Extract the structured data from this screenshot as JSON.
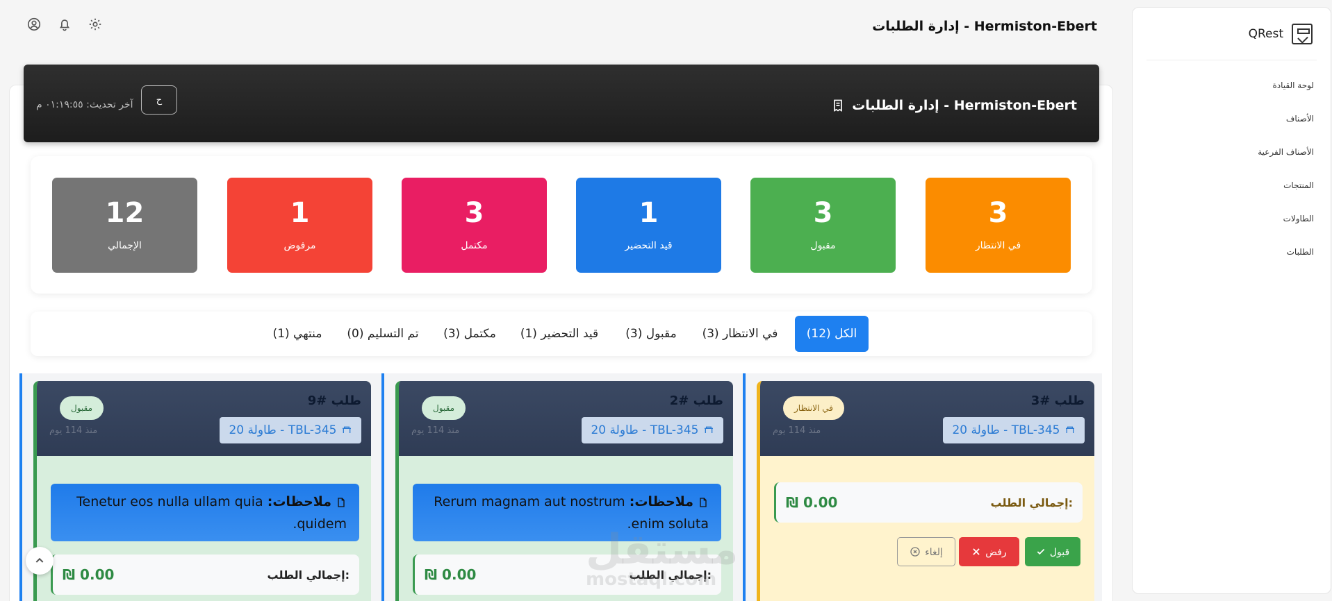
{
  "app": {
    "brand": "QRest",
    "page_title": "إدارة الطلبات - Hermiston-Ebert"
  },
  "sidebar": {
    "items": [
      {
        "label": "لوحة القيادة"
      },
      {
        "label": "الأصناف"
      },
      {
        "label": "الأصناف الفرعية"
      },
      {
        "label": "المنتجات"
      },
      {
        "label": "الطاولات"
      },
      {
        "label": "الطلبات"
      }
    ]
  },
  "topbar": {
    "icons": [
      "user-circle-icon",
      "bell-icon",
      "gear-icon"
    ]
  },
  "banner": {
    "title": "إدارة الطلبات - Hermiston-Ebert",
    "refresh_label": "ح",
    "last_update": "آخر تحديث: ٠١:١٩:٥٥ م"
  },
  "stats": [
    {
      "value": "3",
      "label": "في الانتظار",
      "color": "#fb8c00"
    },
    {
      "value": "3",
      "label": "مقبول",
      "color": "#4caf50"
    },
    {
      "value": "1",
      "label": "قيد التحضير",
      "color": "#1e7ae6"
    },
    {
      "value": "3",
      "label": "مكتمل",
      "color": "#e91e63"
    },
    {
      "value": "1",
      "label": "مرفوض",
      "color": "#f44336"
    },
    {
      "value": "12",
      "label": "الإجمالي",
      "color": "#757575"
    }
  ],
  "tabs": [
    {
      "label": "الكل (12)",
      "active": true
    },
    {
      "label": "في الانتظار (3)"
    },
    {
      "label": "مقبول (3)"
    },
    {
      "label": "قيد التحضير (1)"
    },
    {
      "label": "مكتمل (3)"
    },
    {
      "label": "تم التسليم (0)"
    },
    {
      "label": "منتهي (1)"
    }
  ],
  "orders": [
    {
      "number": "طلب #3",
      "table": "طاولة 20 - TBL-345",
      "status": "في الانتظار",
      "ago": "منذ 114 يوم",
      "total_label": "إجمالي الطلب:",
      "total_value": "₪ 0.00",
      "actions": {
        "accept": "قبول",
        "reject": "رفض",
        "cancel": "إلغاء"
      }
    },
    {
      "number": "طلب #2",
      "table": "طاولة 20 - TBL-345",
      "status": "مقبول",
      "ago": "منذ 114 يوم",
      "notes_label": "ملاحظات:",
      "notes_text": "Rerum magnam aut nostrum enim soluta.",
      "total_label": "إجمالي الطلب:",
      "total_value": "₪ 0.00"
    },
    {
      "number": "طلب #9",
      "table": "طاولة 20 - TBL-345",
      "status": "مقبول",
      "ago": "منذ 114 يوم",
      "notes_label": "ملاحظات:",
      "notes_text": "Tenetur eos nulla ullam quia quidem.",
      "total_label": "إجمالي الطلب:",
      "total_value": "₪ 0.00"
    }
  ],
  "watermark": {
    "arabic": "مستقل",
    "latin": "mostaql.com"
  }
}
